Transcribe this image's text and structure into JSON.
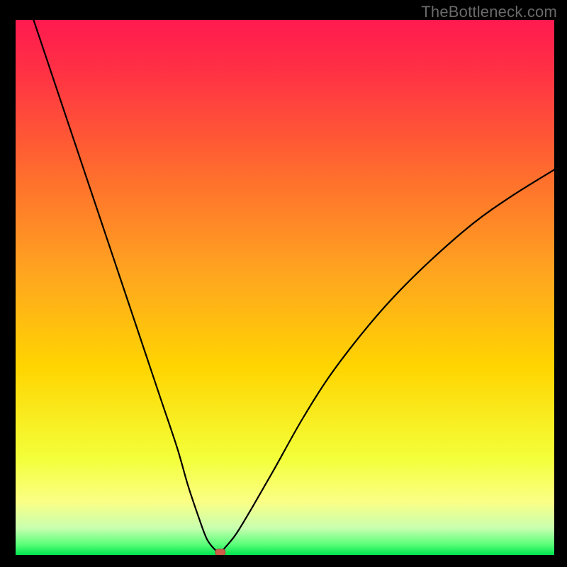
{
  "watermark": "TheBottleneck.com",
  "colors": {
    "bg": "#000000",
    "grad_top": "#ff1a4f",
    "grad_mid": "#ffd500",
    "grad_low": "#fbff85",
    "grad_bottom": "#00e54d",
    "curve": "#000000",
    "marker_fill": "#cf5b49",
    "marker_stroke": "#a94a3c"
  },
  "chart_data": {
    "type": "line",
    "title": "",
    "xlabel": "",
    "ylabel": "",
    "xlim": [
      0,
      100
    ],
    "ylim": [
      0,
      100
    ],
    "series": [
      {
        "name": "bottleneck-curve",
        "x": [
          0,
          3,
          6,
          9,
          12,
          15,
          18,
          21,
          24,
          27,
          30,
          32,
          34,
          35.5,
          37,
          38,
          39,
          41,
          44,
          48,
          53,
          58,
          64,
          70,
          77,
          85,
          92,
          100
        ],
        "y": [
          110,
          101,
          92,
          83,
          74,
          65,
          56,
          47,
          38,
          29,
          20,
          13,
          7,
          3,
          1,
          0.5,
          1.5,
          4,
          9,
          16,
          25,
          33,
          41,
          48,
          55,
          62,
          67,
          72
        ]
      }
    ],
    "marker": {
      "x": 38,
      "y": 0.5
    },
    "legend": []
  }
}
